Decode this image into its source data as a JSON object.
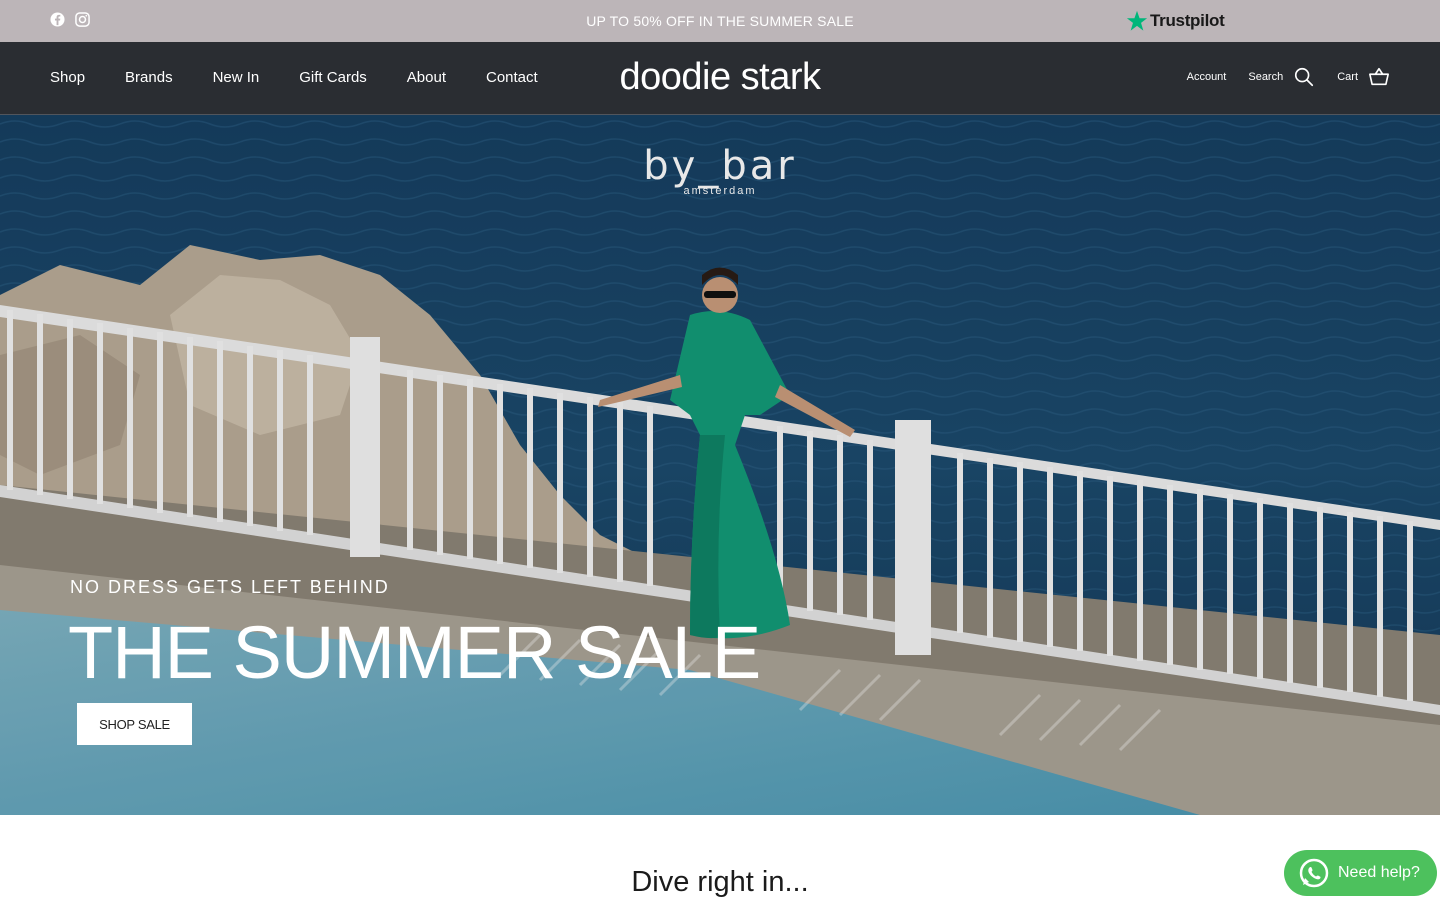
{
  "announcement": {
    "text": "UP TO 50% OFF IN THE SUMMER SALE",
    "social_icons": [
      "facebook-icon",
      "instagram-icon"
    ],
    "trustpilot_label": "Trustpilot"
  },
  "header": {
    "nav": [
      "Shop",
      "Brands",
      "New In",
      "Gift Cards",
      "About",
      "Contact"
    ],
    "logo": "doodie stark",
    "account_label": "Account",
    "search_label": "Search",
    "cart_label": "Cart"
  },
  "hero": {
    "brand_name": "by_bar",
    "brand_sub": "amsterdam",
    "eyebrow": "NO DRESS GETS LEFT BEHIND",
    "headline": "THE SUMMER SALE",
    "cta_label": "SHOP SALE"
  },
  "section": {
    "title": "Dive right in..."
  },
  "whatsapp": {
    "label": "Need help?"
  },
  "colors": {
    "announcement_bg": "#bcb5b8",
    "header_bg": "#2a2d32",
    "trustpilot_green": "#00b67a",
    "whatsapp_green": "#4dc15d"
  }
}
